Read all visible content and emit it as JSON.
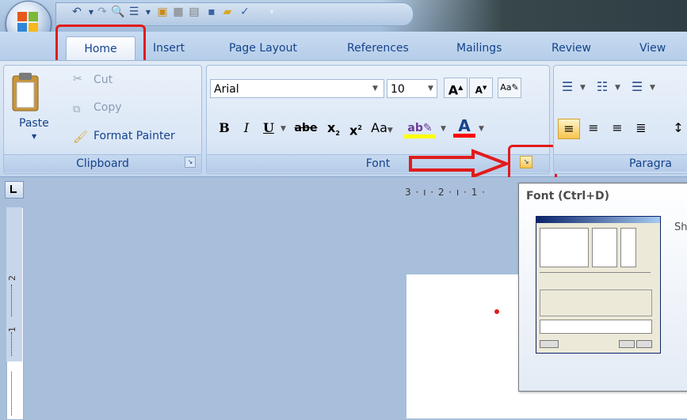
{
  "tabs": {
    "home": "Home",
    "insert": "Insert",
    "page_layout": "Page Layout",
    "references": "References",
    "mailings": "Mailings",
    "review": "Review",
    "view": "View"
  },
  "clipboard": {
    "cut": "Cut",
    "copy": "Copy",
    "paste": "Paste",
    "format_painter": "Format Painter",
    "label": "Clipboard"
  },
  "font": {
    "name": "Arial",
    "size": "10",
    "label": "Font",
    "change_case": "Aa"
  },
  "paragraph": {
    "label_truncated": "Paragra"
  },
  "ruler": {
    "top_marks": "3 · ı · 2 · ı · 1 ·",
    "left_2": "2",
    "left_1": "1"
  },
  "tooltip": {
    "title": "Font (Ctrl+D)",
    "desc_truncated": "Sh"
  },
  "colors": {
    "accent_red": "#e21b1b",
    "highlight": "#ffff00",
    "font_color": "#ff0000"
  }
}
